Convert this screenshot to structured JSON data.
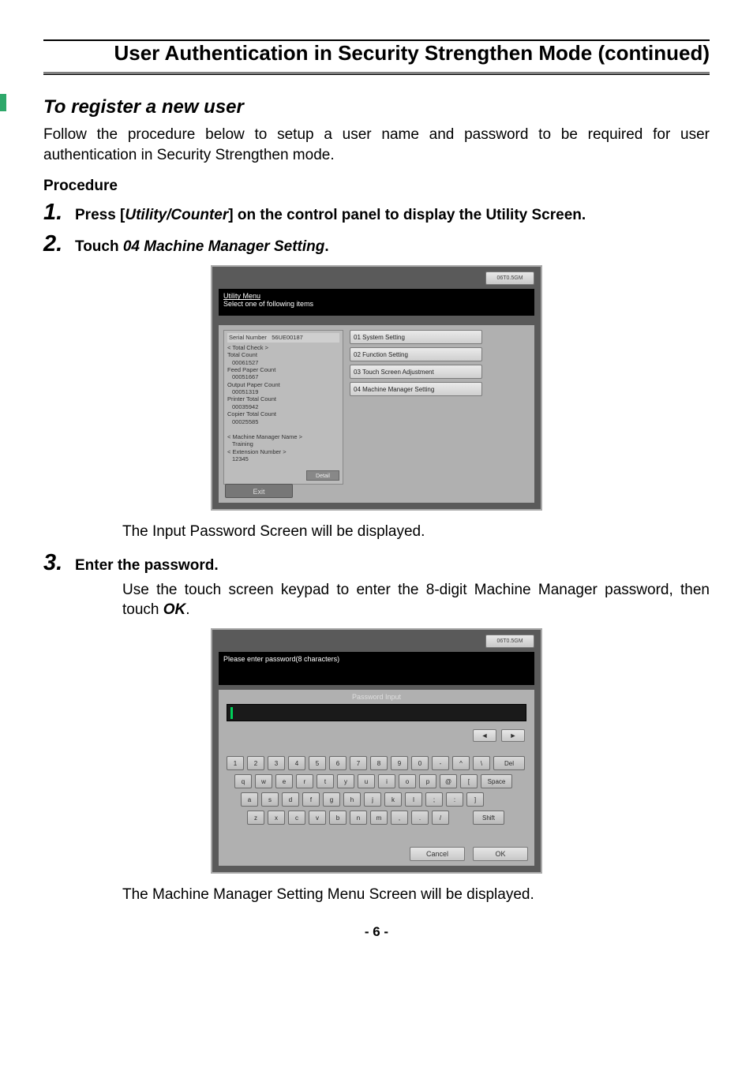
{
  "header": {
    "title": "User Authentication in Security Strengthen Mode (continued)"
  },
  "subtitle": "To register a new user",
  "intro": "Follow the procedure below to setup a user name and password to be required for user authentication in Security Strengthen mode.",
  "procedure_label": "Procedure",
  "steps": {
    "s1": {
      "num": "1.",
      "pre": "Press [",
      "em": "Utility/Counter",
      "post": "] on the control panel to display the Utility Screen."
    },
    "s2": {
      "num": "2.",
      "pre": "Touch ",
      "em": "04 Machine Manager Setting",
      "post": "."
    },
    "s3": {
      "num": "3.",
      "text": "Enter the password."
    }
  },
  "after_shot1": "The Input Password Screen will be displayed.",
  "step3_body_pre": "Use the touch screen keypad to enter the 8-digit Machine Manager password, then touch ",
  "step3_body_em": "OK",
  "step3_body_post": ".",
  "after_shot2": "The Machine Manager Setting Menu Screen will be displayed.",
  "pagenum": "- 6 -",
  "shot1": {
    "job_mem": "06T0.5GM",
    "bar_title": "Utility Menu",
    "bar_sub": "Select one of following items",
    "left": {
      "serial_label": "Serial Number",
      "serial_value": "56UE00187",
      "total_check": "< Total Check >",
      "total_count_l": "Total Count",
      "total_count_v": "00061527",
      "feed_l": "Feed Paper Count",
      "feed_v": "00051667",
      "output_l": "Output Paper Count",
      "output_v": "00051319",
      "printer_l": "Printer Total Count",
      "printer_v": "00035942",
      "copier_l": "Copier Total Count",
      "copier_v": "00025585",
      "mm_name_l": "< Machine Manager Name >",
      "mm_name_v": "Training",
      "ext_l": "< Extension Number >",
      "ext_v": "12345",
      "detail": "Detail"
    },
    "menu": {
      "m1": "01 System Setting",
      "m2": "02 Function Setting",
      "m3": "03 Touch Screen Adjustment",
      "m4": "04 Machine Manager Setting"
    },
    "exit": "Exit"
  },
  "shot2": {
    "job_mem": "06T0.5GM",
    "bar_title": "Please enter password(8 characters)",
    "pw_label": "Password Input",
    "arrows": {
      "left": "◄",
      "right": "►"
    },
    "keys": {
      "r1": [
        "1",
        "2",
        "3",
        "4",
        "5",
        "6",
        "7",
        "8",
        "9",
        "0",
        "-",
        "^",
        "\\"
      ],
      "r1_del": "Del",
      "r2": [
        "q",
        "w",
        "e",
        "r",
        "t",
        "y",
        "u",
        "i",
        "o",
        "p",
        "@",
        "["
      ],
      "r2_space": "Space",
      "r3": [
        "a",
        "s",
        "d",
        "f",
        "g",
        "h",
        "j",
        "k",
        "l",
        ";",
        ":",
        "]"
      ],
      "r4": [
        "z",
        "x",
        "c",
        "v",
        "b",
        "n",
        "m",
        ",",
        ".",
        "/"
      ],
      "r4_shift": "Shift"
    },
    "cancel": "Cancel",
    "ok": "OK"
  }
}
